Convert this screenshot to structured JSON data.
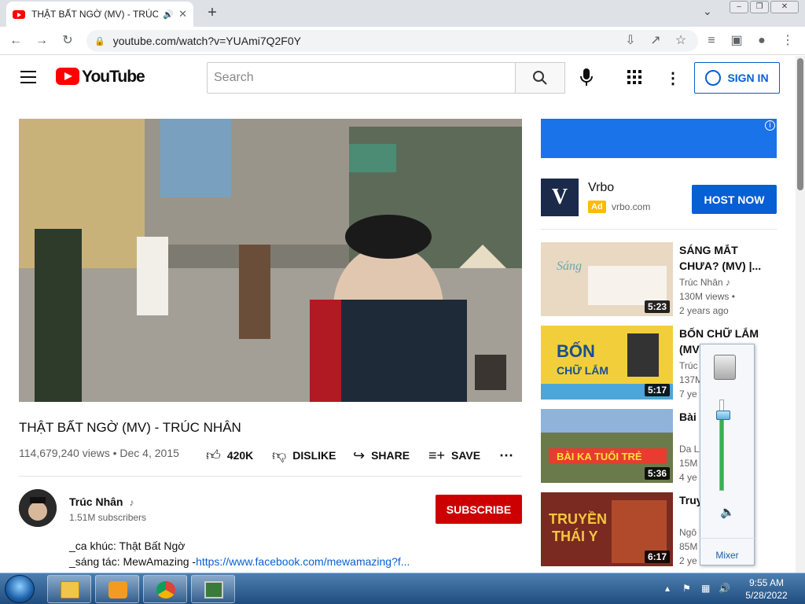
{
  "browser": {
    "tab_title": "THẬT BẤT NGỜ (MV) - TRÚC",
    "tab_sound_icon": "speaker-icon",
    "tab_close": "✕",
    "new_tab": "+",
    "url": "youtube.com/watch?v=YUAmi7Q2F0Y"
  },
  "masthead": {
    "logo_text": "YouTube",
    "search_placeholder": "Search",
    "sign_in": "SIGN IN"
  },
  "video": {
    "title": "THẬT BẤT NGỜ (MV) - TRÚC NHÂN",
    "meta": "114,679,240 views • Dec 4, 2015",
    "likes": "420K",
    "dislike": "DISLIKE",
    "share": "SHARE",
    "save": "SAVE",
    "channel": "Trúc Nhân",
    "channel_note": "♪",
    "subscribers": "1.51M subscribers",
    "subscribe": "SUBSCRIBE",
    "desc_line1": "_ca khúc: Thật Bất Ngờ",
    "desc_line2_prefix": "_sáng tác: MewAmazing -",
    "desc_line2_link": "https://www.facebook.com/mewamazing?f..."
  },
  "ad": {
    "advertiser": "Vrbo",
    "badge": "Ad",
    "url": "vrbo.com",
    "cta": "HOST NOW",
    "info": "i",
    "logo_letter": "V"
  },
  "recommendations": [
    {
      "title": "SÁNG MẮT CHƯA? (MV) |...",
      "channel": "Trúc Nhân ♪",
      "views": "130M views •",
      "age": "2 years ago",
      "duration": "5:23",
      "color": "#e9d8c2"
    },
    {
      "title": "BỐN CHỮ LẮM (MV) | ...",
      "channel": "Trúc",
      "views": "137M",
      "age": "7 ye",
      "duration": "5:17",
      "color": "#f2cf3a"
    },
    {
      "title": "Bài K - Tan",
      "channel": "Da LA",
      "views": "15M",
      "age": "4 ye",
      "duration": "5:36",
      "color": "#6b9a4a"
    },
    {
      "title": "Truy Ngô",
      "channel": "Ngô",
      "views": "85M",
      "age": "2 ye",
      "duration": "6:17",
      "color": "#7a2a20"
    }
  ],
  "volume_mixer": {
    "level": 0.82,
    "mixer_label": "Mixer"
  },
  "taskbar": {
    "time": "9:55 AM",
    "date": "5/28/2022"
  }
}
